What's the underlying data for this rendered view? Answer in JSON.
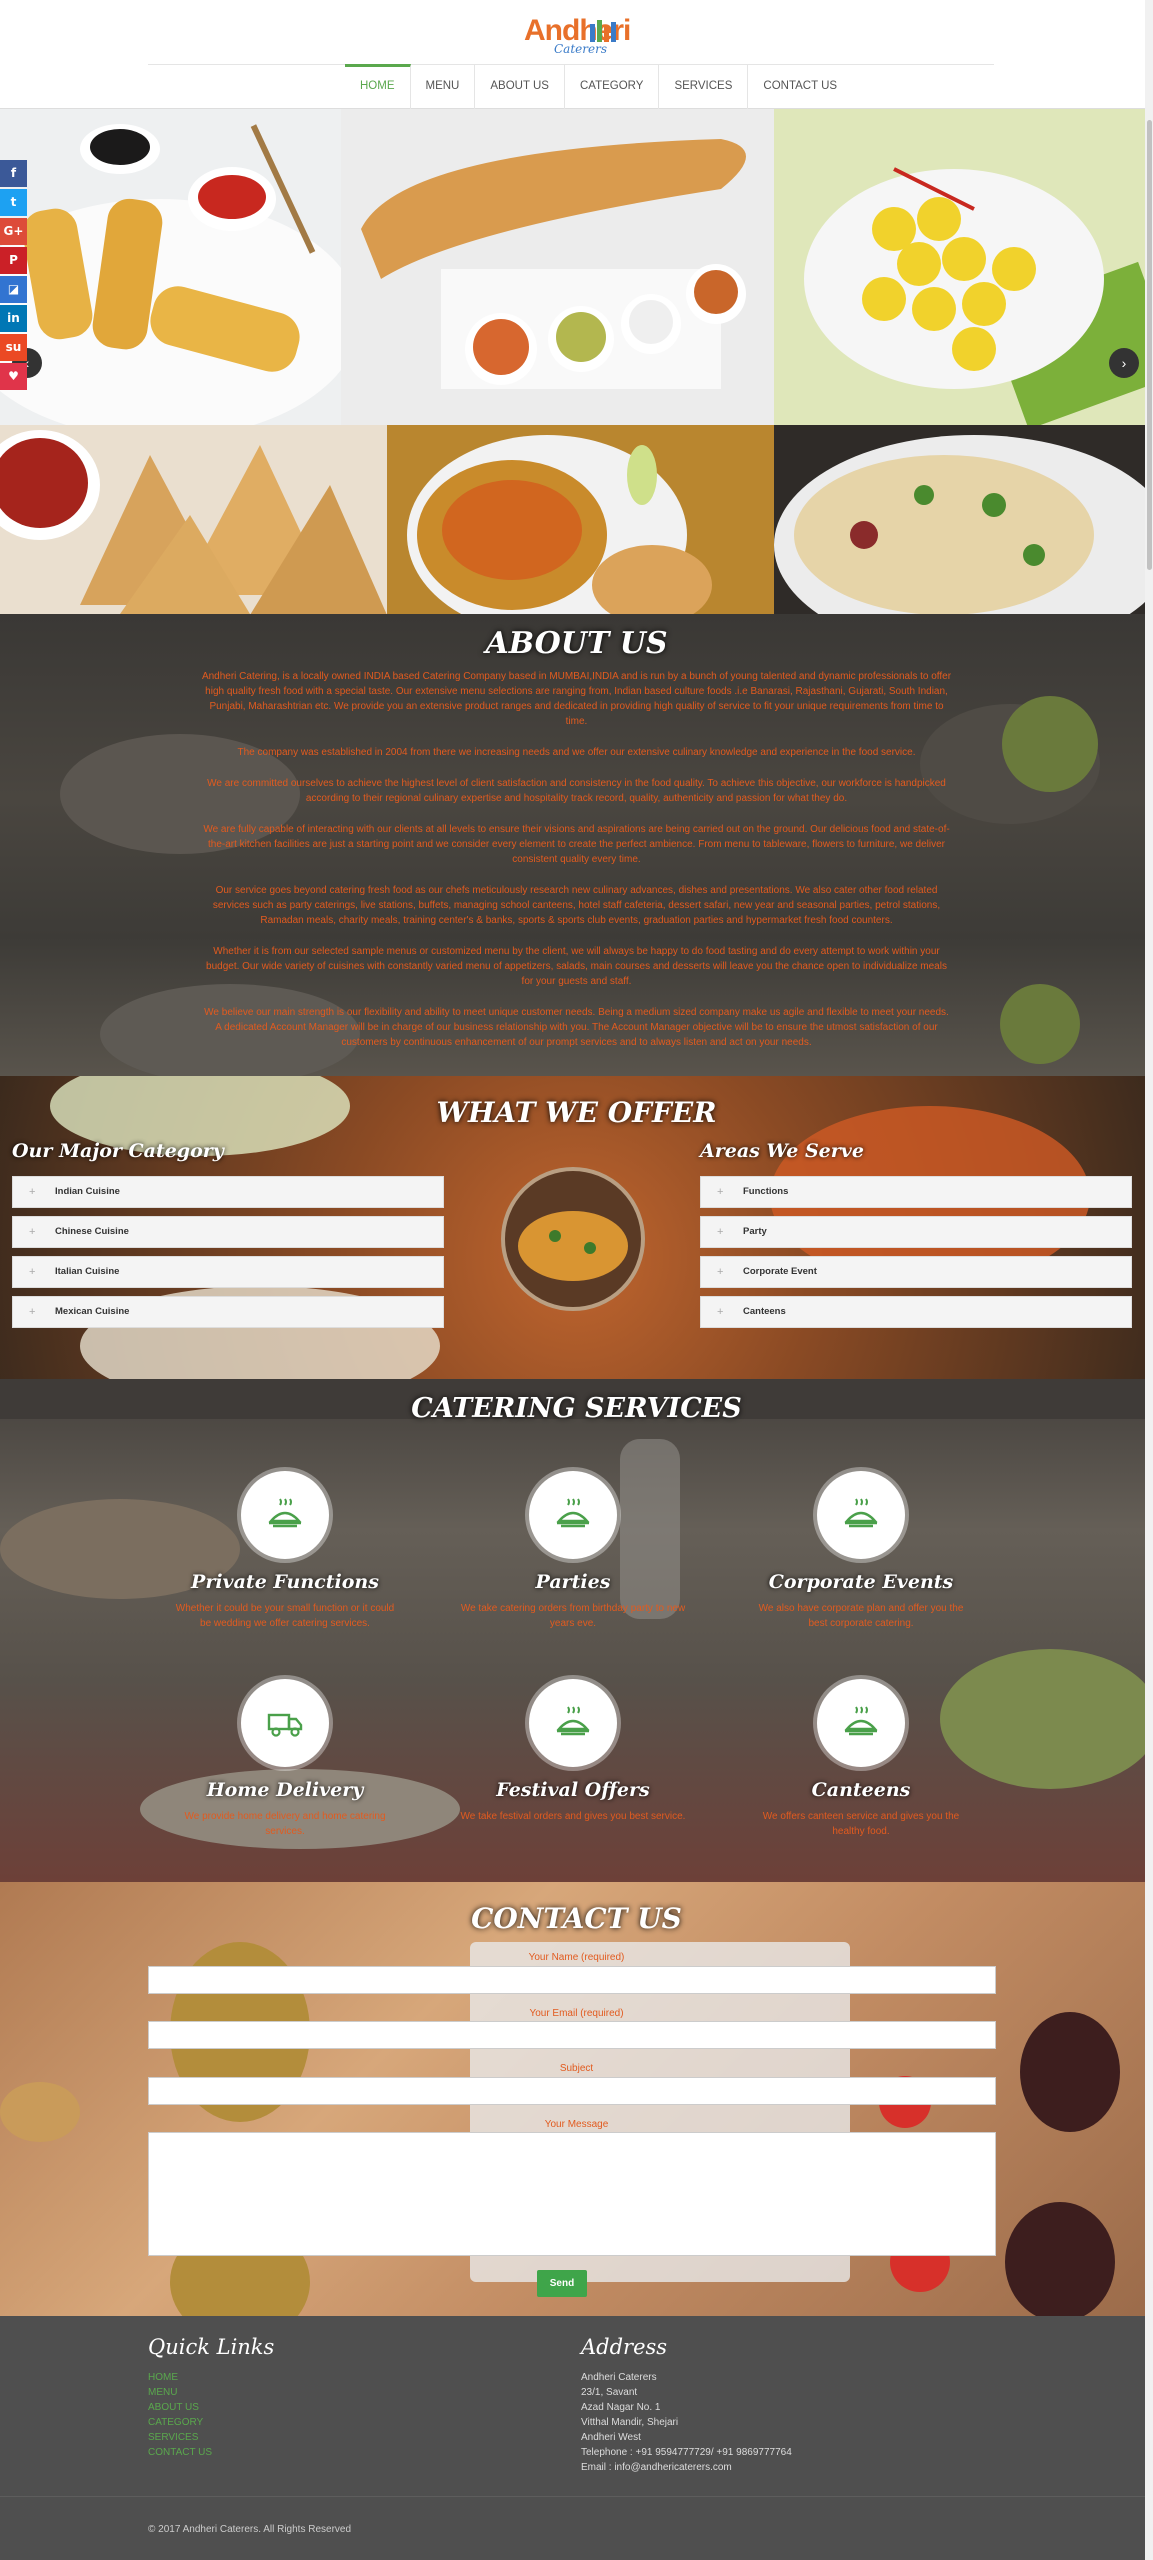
{
  "header": {
    "logo_main": "Andheri",
    "logo_sub": "Caterers",
    "nav": [
      {
        "label": "HOME",
        "active": true
      },
      {
        "label": "MENU"
      },
      {
        "label": "ABOUT US"
      },
      {
        "label": "CATEGORY"
      },
      {
        "label": "SERVICES"
      },
      {
        "label": "CONTACT US"
      }
    ]
  },
  "social": [
    {
      "icon": "facebook-icon",
      "glyph": "f",
      "color": "#3b5998"
    },
    {
      "icon": "twitter-icon",
      "glyph": "t",
      "color": "#1da1f2"
    },
    {
      "icon": "google-plus-icon",
      "glyph": "G+",
      "color": "#dd4b39"
    },
    {
      "icon": "pinterest-icon",
      "glyph": "P",
      "color": "#cb2027"
    },
    {
      "icon": "delicious-icon",
      "glyph": "◪",
      "color": "#3274d1"
    },
    {
      "icon": "linkedin-icon",
      "glyph": "in",
      "color": "#0077b5"
    },
    {
      "icon": "stumbleupon-icon",
      "glyph": "su",
      "color": "#eb4924"
    },
    {
      "icon": "heart-icon",
      "glyph": "♥",
      "color": "#e0344a"
    }
  ],
  "slider": {
    "prev_glyph": "‹",
    "next_glyph": "›"
  },
  "about": {
    "title": "ABOUT US",
    "paragraphs": [
      "Andheri Catering, is a locally owned INDIA based Catering Company based in MUMBAI,INDIA and is run by a bunch of young talented and dynamic professionals to offer high quality fresh food with a special taste. Our extensive menu selections are ranging from, Indian based culture foods .i.e Banarasi, Rajasthani, Gujarati, South Indian, Punjabi, Maharashtrian etc. We provide you an extensive product ranges and dedicated in providing high quality of service to fit your unique requirements from time to time.",
      "The company was established in 2004 from there we increasing needs and we offer our extensive culinary knowledge and experience in the food service.",
      "We are committed ourselves to achieve the highest level of client satisfaction and consistency in the food quality. To achieve this objective, our workforce is handpicked according to their regional culinary expertise and hospitality track record, quality, authenticity and passion for what they do.",
      "We are fully capable of interacting with our clients at all levels to ensure their visions and aspirations are being carried out on the ground. Our delicious food and state-of-the-art kitchen facilities are just a starting point and we consider every element to create the perfect ambience. From menu to tableware, flowers to furniture, we deliver consistent quality every time.",
      "Our service goes beyond catering fresh food as our chefs meticulously research new culinary advances, dishes and presentations. We also cater other food related services such as party caterings, live stations, buffets, managing school canteens, hotel staff cafeteria, dessert safari, new year and seasonal parties, petrol stations, Ramadan meals, charity meals, training center's & banks, sports & sports club events, graduation parties and hypermarket fresh food counters.",
      "Whether it is from our selected sample menus or customized menu by the client, we will always be happy to do food tasting and do every attempt to work within your budget. Our wide variety of cuisines with constantly varied menu of appetizers, salads, main courses and desserts will leave you the chance open to individualize meals for your guests and staff.",
      "We believe our main strength is our flexibility and ability to meet unique customer needs. Being a medium sized company make us agile and flexible to meet your needs. A dedicated Account Manager will be in charge of our business relationship with you. The Account Manager objective will be to ensure the utmost satisfaction of our customers by continuous enhancement of our prompt services and to always listen and act on your needs."
    ]
  },
  "offer": {
    "title": "WHAT WE OFFER",
    "left_title": "Our Major Category",
    "left_items": [
      "Indian Cuisine",
      "Chinese Cuisine",
      "Italian Cuisine",
      "Mexican Cuisine"
    ],
    "right_title": "Areas We Serve",
    "right_items": [
      "Functions",
      "Party",
      "Corporate Event",
      "Canteens"
    ]
  },
  "services": {
    "title": "CATERING SERVICES",
    "items": [
      {
        "title": "Private Functions",
        "desc": "Whether it could be your small function or it could be wedding we offer catering services.",
        "icon": "food-tray-icon"
      },
      {
        "title": "Parties",
        "desc": "We take catering orders from birthday party to new years eve.",
        "icon": "food-tray-icon"
      },
      {
        "title": "Corporate Events",
        "desc": "We also have corporate plan and offer you the best corporate catering.",
        "icon": "food-tray-icon"
      },
      {
        "title": "Home Delivery",
        "desc": "We provide home delivery and home catering services.",
        "icon": "delivery-truck-icon"
      },
      {
        "title": "Festival Offers",
        "desc": "We take festival orders and gives you best service.",
        "icon": "food-tray-icon"
      },
      {
        "title": "Canteens",
        "desc": "We offers canteen service and gives you the healthy food.",
        "icon": "food-tray-icon"
      }
    ]
  },
  "contact": {
    "title": "CONTACT US",
    "name_label": "Your Name (required)",
    "email_label": "Your Email (required)",
    "subject_label": "Subject",
    "message_label": "Your Message",
    "send_label": "Send"
  },
  "footer": {
    "links_title": "Quick Links",
    "links": [
      "HOME",
      "MENU",
      "ABOUT US",
      "CATEGORY",
      "SERVICES",
      "CONTACT US"
    ],
    "address_title": "Address",
    "address": [
      "Andheri Caterers",
      "23/1, Savant",
      "Azad Nagar No. 1",
      "Vitthal Mandir, Shejari",
      "Andheri West",
      "Telephone : +91 9594777729/ +91 9869777764",
      "Email : info@andhericaterers.com"
    ],
    "copyright": "© 2017 Andheri Caterers. All Rights Reserved"
  },
  "colors": {
    "accent": "#5aa84d",
    "text_orange": "#e25b1f",
    "footer_bg": "#4f4f4f",
    "logo_orange": "#e8702a",
    "logo_blue": "#3a7bc8"
  }
}
